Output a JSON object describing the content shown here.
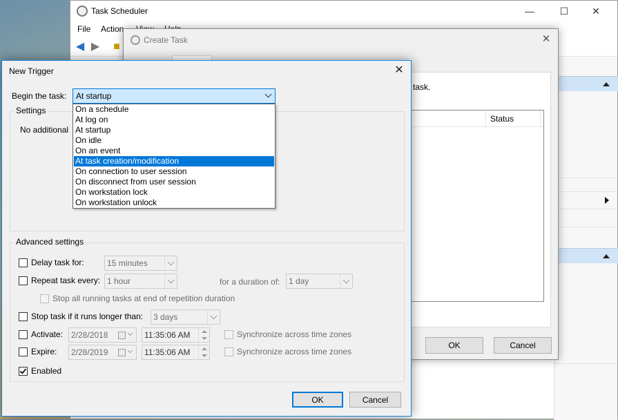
{
  "task_scheduler": {
    "title": "Task Scheduler",
    "menu": [
      "File",
      "Action",
      "View",
      "Help"
    ],
    "caption_minimize": "—",
    "caption_maximize": "☐",
    "caption_close": "✕"
  },
  "create_task": {
    "title": "Create Task",
    "close": "✕",
    "description_fragment": "e task.",
    "column_status": "Status",
    "ok_label": "OK",
    "cancel_label": "Cancel"
  },
  "new_trigger": {
    "title": "New Trigger",
    "close": "✕",
    "begin_label": "Begin the task:",
    "begin_value": "At startup",
    "options": [
      "On a schedule",
      "At log on",
      "At startup",
      "On idle",
      "On an event",
      "At task creation/modification",
      "On connection to user session",
      "On disconnect from user session",
      "On workstation lock",
      "On workstation unlock"
    ],
    "highlighted_option": "At task creation/modification",
    "settings_title": "Settings",
    "settings_text": "No additional",
    "advanced_title": "Advanced settings",
    "delay_label": "Delay task for:",
    "delay_value": "15 minutes",
    "repeat_label": "Repeat task every:",
    "repeat_value": "1 hour",
    "duration_label": "for a duration of:",
    "duration_value": "1 day",
    "stop_all_label": "Stop all running tasks at end of repetition duration",
    "stop_longer_label": "Stop task if it runs longer than:",
    "stop_longer_value": "3 days",
    "activate_label": "Activate:",
    "activate_date": "2/28/2018",
    "activate_time": "11:35:06 AM",
    "expire_label": "Expire:",
    "expire_date": "2/28/2019",
    "expire_time": "11:35:06 AM",
    "sync_label": "Synchronize across time zones",
    "enabled_label": "Enabled",
    "enabled_checked": true,
    "ok_label": "OK",
    "cancel_label": "Cancel"
  },
  "colors": {
    "accent": "#0078d7",
    "selection_bg": "#cce8ff"
  }
}
